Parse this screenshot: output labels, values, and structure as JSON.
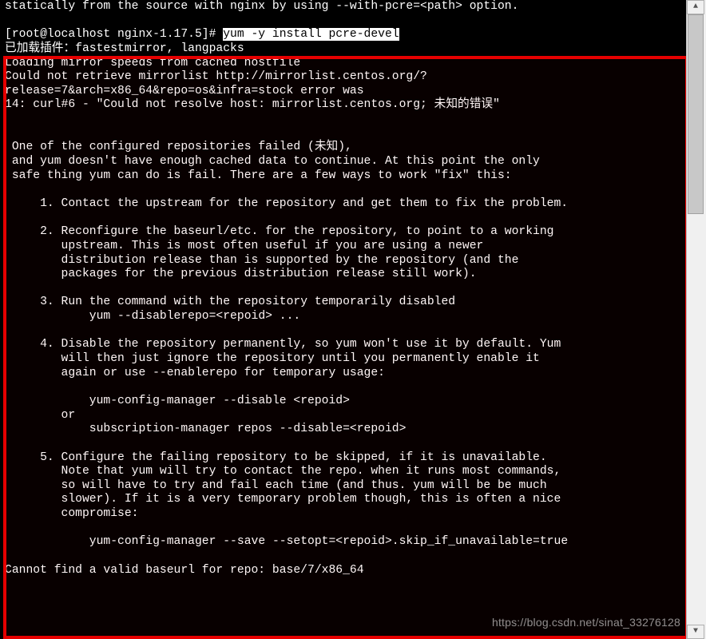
{
  "preamble": {
    "nginx_tail": "statically from the source with nginx by using --with-pcre=<path> option.",
    "prompt": "[root@localhost nginx-1.17.5]# ",
    "command": "yum -y install pcre-devel",
    "plugin_line": "已加载插件：fastestmirror, langpacks"
  },
  "error_block": {
    "l1": "Loading mirror speeds from cached hostfile",
    "l2": "Could not retrieve mirrorlist http://mirrorlist.centos.org/?release=7&arch=x86_64&repo=os&infra=stock error was",
    "l3": "14: curl#6 - \"Could not resolve host: mirrorlist.centos.org; 未知的错误\"",
    "msg1": " One of the configured repositories failed (未知),",
    "msg2": " and yum doesn't have enough cached data to continue. At this point the only",
    "msg3": " safe thing yum can do is fail. There are a few ways to work \"fix\" this:",
    "opt1": "     1. Contact the upstream for the repository and get them to fix the problem.",
    "opt2a": "     2. Reconfigure the baseurl/etc. for the repository, to point to a working",
    "opt2b": "        upstream. This is most often useful if you are using a newer",
    "opt2c": "        distribution release than is supported by the repository (and the",
    "opt2d": "        packages for the previous distribution release still work).",
    "opt3a": "     3. Run the command with the repository temporarily disabled",
    "opt3b": "            yum --disablerepo=<repoid> ...",
    "opt4a": "     4. Disable the repository permanently, so yum won't use it by default. Yum",
    "opt4b": "        will then just ignore the repository until you permanently enable it",
    "opt4c": "        again or use --enablerepo for temporary usage:",
    "opt4d": "            yum-config-manager --disable <repoid>",
    "opt4e": "        or",
    "opt4f": "            subscription-manager repos --disable=<repoid>",
    "opt5a": "     5. Configure the failing repository to be skipped, if it is unavailable.",
    "opt5b": "        Note that yum will try to contact the repo. when it runs most commands,",
    "opt5c": "        so will have to try and fail each time (and thus. yum will be be much",
    "opt5d": "        slower). If it is a very temporary problem though, this is often a nice",
    "opt5e": "        compromise:",
    "opt5f": "            yum-config-manager --save --setopt=<repoid>.skip_if_unavailable=true",
    "final": "Cannot find a valid baseurl for repo: base/7/x86_64"
  },
  "watermark": "https://blog.csdn.net/sinat_33276128",
  "scrollbar": {
    "up": "▲",
    "down": "▼"
  }
}
